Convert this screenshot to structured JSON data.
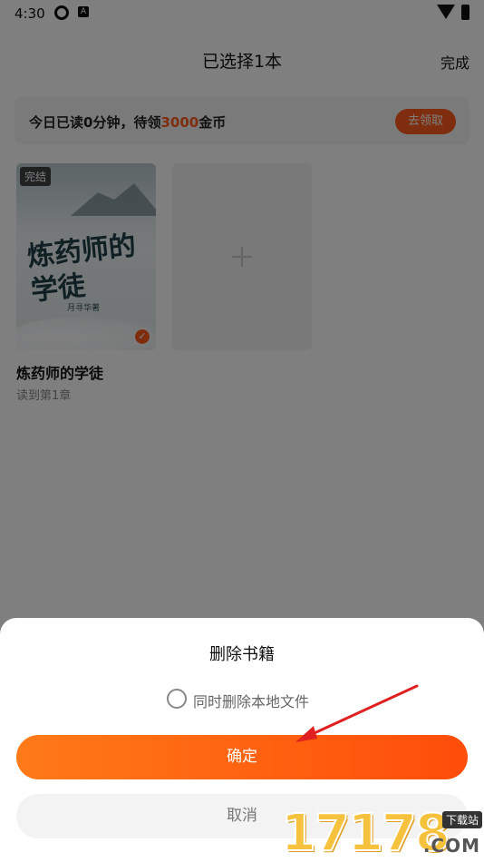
{
  "status_bar": {
    "time": "4:30",
    "notification_letter": "A"
  },
  "header": {
    "title": "已选择1本",
    "done_label": "完成"
  },
  "reward": {
    "text_before": "今日已读0分钟，待领",
    "amount": "3000",
    "text_after": "金币",
    "button_label": "去领取",
    "accent_color": "#ff5a1f"
  },
  "books": [
    {
      "tag": "完结",
      "cover_title": "炼药师的学徒",
      "cover_author": "月寻华著",
      "name": "炼药师的学徒",
      "progress": "读到第1章",
      "selected": true
    }
  ],
  "add_card": {
    "icon": "plus-icon"
  },
  "dialog": {
    "title": "删除书籍",
    "option_label": "同时删除本地文件",
    "option_checked": false,
    "confirm_label": "确定",
    "cancel_label": "取消"
  },
  "watermark": {
    "digits": "17178",
    "tag": "下载站",
    "suffix": ".COM"
  }
}
